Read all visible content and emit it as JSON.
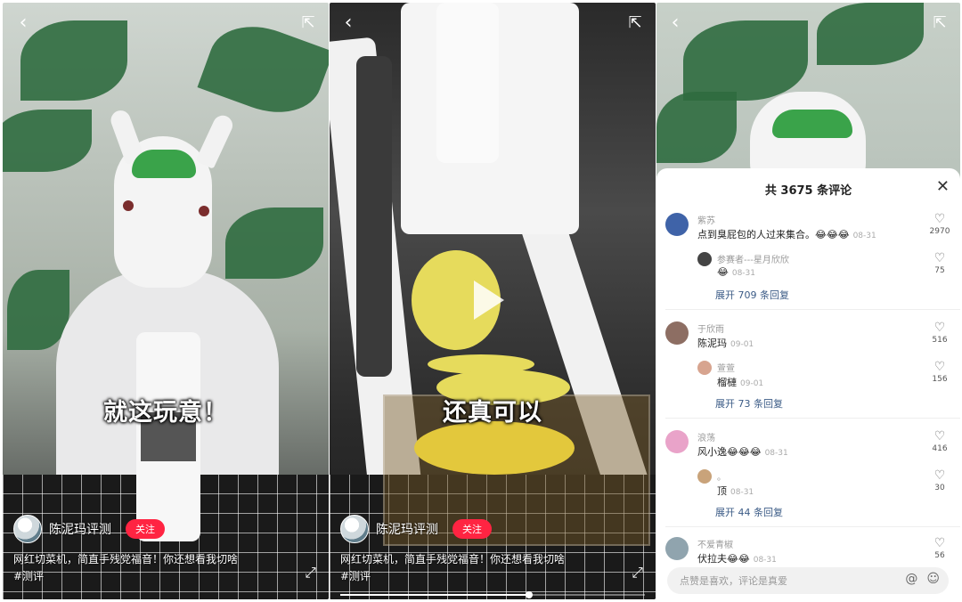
{
  "panel1": {
    "caption": "就这玩意！",
    "author": "陈泥玛评测",
    "follow_label": "关注",
    "desc_line1": "网红切菜机，简直手残党福音！你还想看我切啥",
    "desc_line2": "#测评"
  },
  "panel2": {
    "caption": "还真可以",
    "author": "陈泥玛评测",
    "follow_label": "关注",
    "desc_line1": "网红切菜机，简直手残党福音！你还想看我切啥",
    "desc_line2": "#测评",
    "progress": 0.62
  },
  "comments": {
    "title": "共 3675 条评论",
    "items": [
      {
        "name": "紫苏",
        "text": "点到臭屁包的人过来集合。😂😂😂",
        "date": "08-31",
        "likes": "2970",
        "reply": {
          "name": "参赛者---星月欣欣",
          "text": "😂",
          "date": "08-31",
          "likes": "75"
        },
        "more": "展开 709 条回复"
      },
      {
        "name": "于欣雨",
        "text": "陈泥玛",
        "date": "09-01",
        "likes": "516",
        "reply": {
          "name": "萱萱",
          "text": "榴槤",
          "date": "09-01",
          "likes": "156"
        },
        "more": "展开 73 条回复"
      },
      {
        "name": "浪荡",
        "text": "风小逸😂😂😂",
        "date": "08-31",
        "likes": "416",
        "reply": {
          "name": "。",
          "text": "顶",
          "date": "08-31",
          "likes": "30"
        },
        "more": "展开 44 条回复"
      },
      {
        "name": "不爱青椒",
        "text": "伏拉夫😂😂",
        "date": "08-31",
        "likes": "56"
      }
    ],
    "input_placeholder": "点赞是喜欢，评论是真爱"
  },
  "icons": {
    "back": "back-arrow-icon",
    "share": "share-icon",
    "close": "close-icon",
    "heart": "heart-icon",
    "at": "at-icon",
    "emoji": "emoji-icon",
    "play": "play-icon",
    "expand": "fullscreen-icon"
  },
  "colors": {
    "follow": "#ff2442",
    "link": "#3b5b86",
    "tuft": "#3aa34a"
  }
}
